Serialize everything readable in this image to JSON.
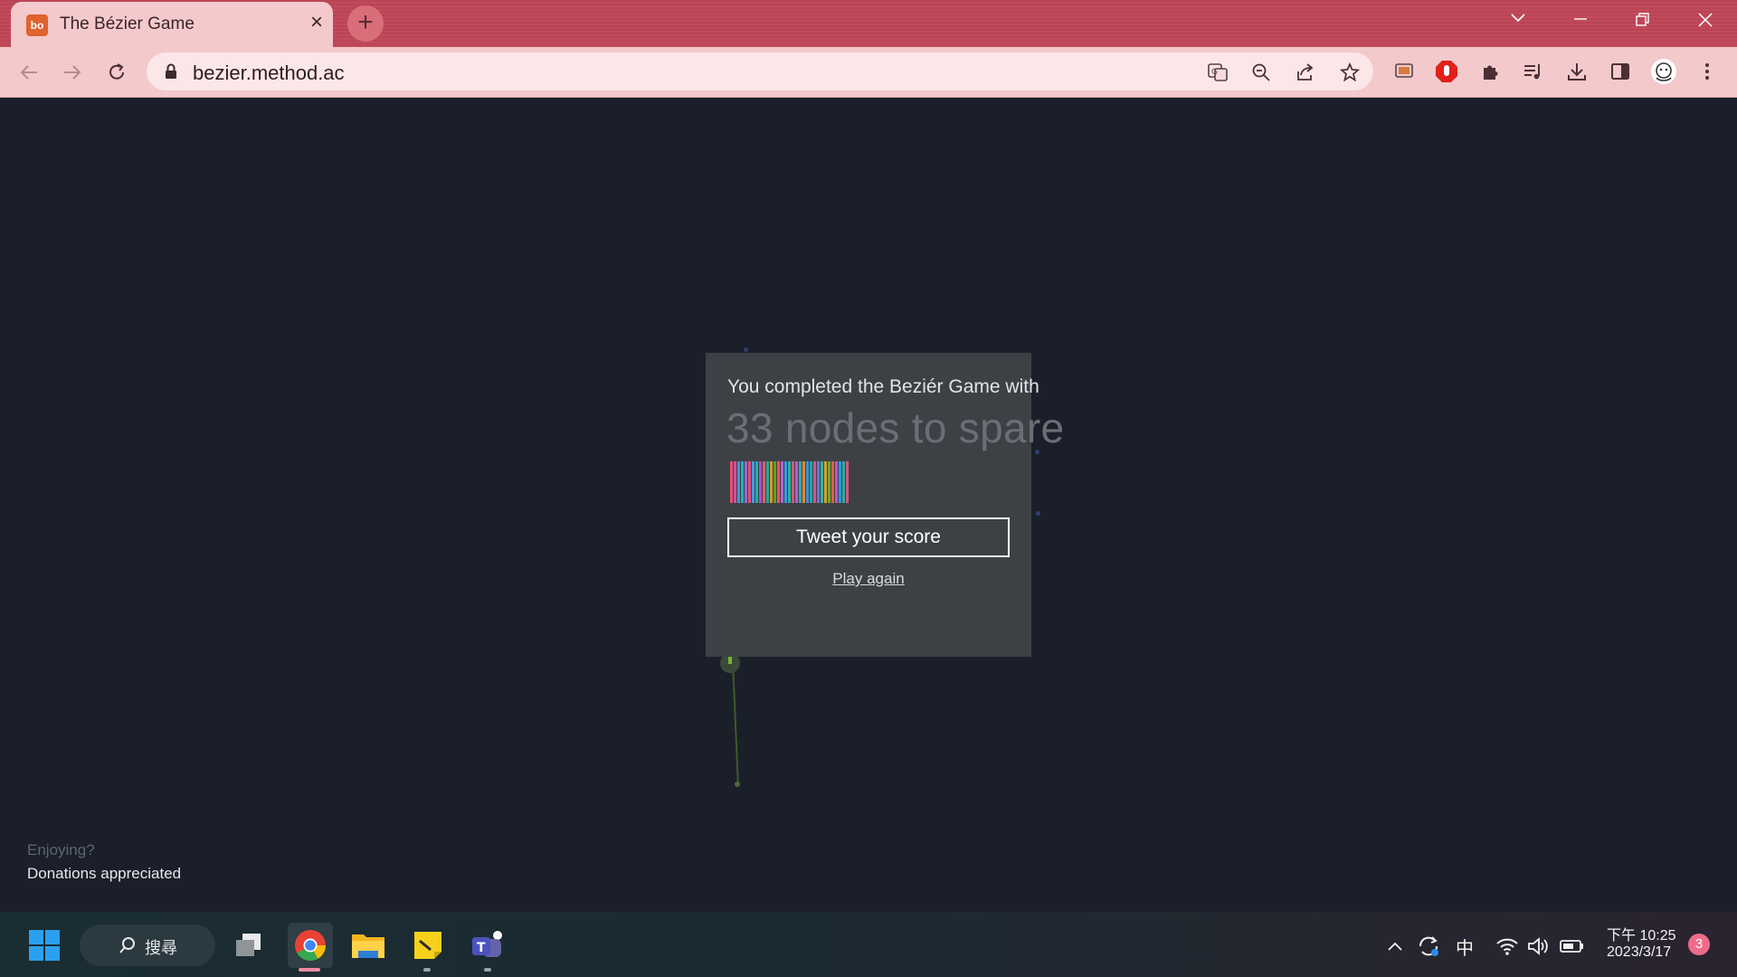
{
  "browser": {
    "tab_title": "The Bézier Game",
    "favicon_text": "bo",
    "url": "bezier.method.ac",
    "theme_color": "#c24b5b"
  },
  "page": {
    "completion_text": "You completed the Beziér Game with",
    "score_text": "33 nodes to spare",
    "nodes_to_spare": 33,
    "tweet_button": "Tweet your score",
    "play_again": "Play again",
    "enjoying_text": "Enjoying?",
    "donations_text": "Donations appreciated",
    "bar_colors": [
      "#e8536c",
      "#d34fa3",
      "#3b9ad6",
      "#25b0b5",
      "#8d6fd1",
      "#e14d86",
      "#3f9fe0",
      "#20b2a6",
      "#b04bd2",
      "#e75a78",
      "#2aa79b",
      "#d79a1e",
      "#6b9a2d",
      "#e25d4f",
      "#c45bcf",
      "#3a9ae1",
      "#29b5a4",
      "#e44f76",
      "#a468cf",
      "#2fa6c8",
      "#e48a2a",
      "#3d8fe2",
      "#1eaaa0",
      "#dd4f94",
      "#7c6fd6",
      "#2fb3b0",
      "#d7a221",
      "#79a430",
      "#e2604a",
      "#c055c8",
      "#3891df",
      "#25b0a4",
      "#e0527a"
    ]
  },
  "taskbar": {
    "search_label": "搜尋",
    "ime_label": "中",
    "time": "下午 10:25",
    "date": "2023/3/17",
    "notification_count": "3"
  }
}
